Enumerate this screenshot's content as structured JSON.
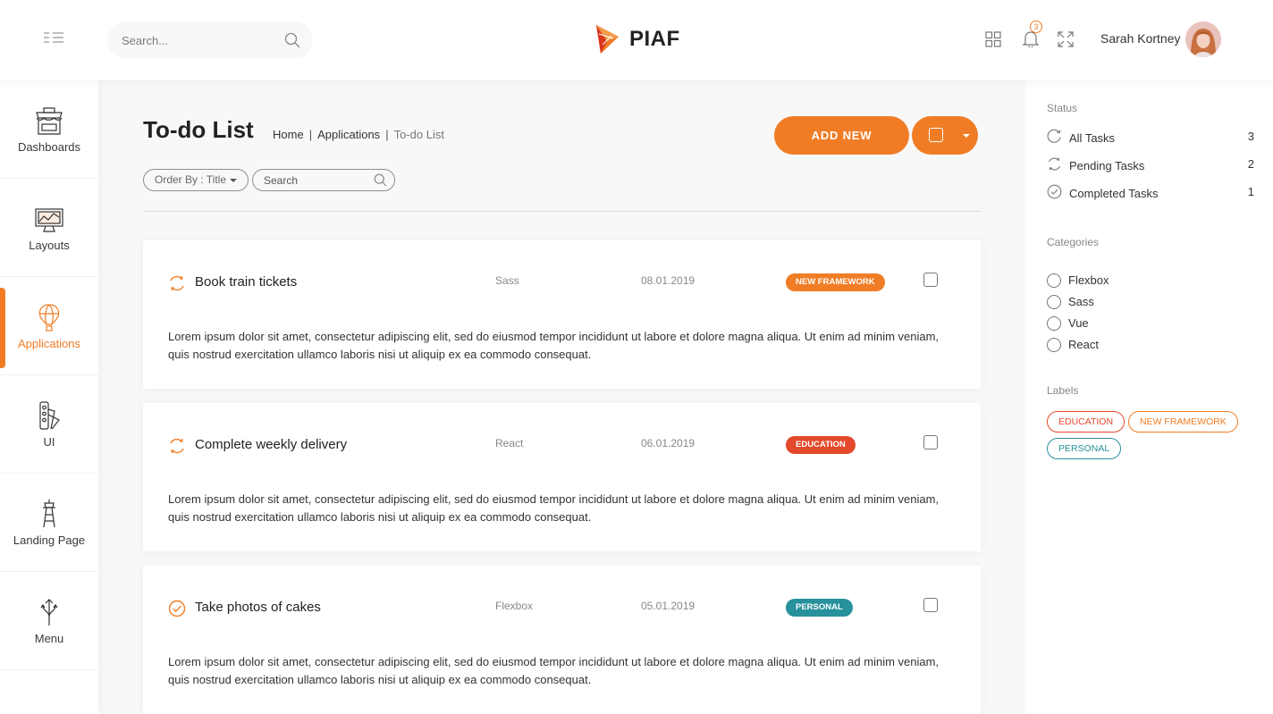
{
  "colors": {
    "accent": "#f07d26",
    "education": "#e3492b",
    "new_framework": "#f07d26",
    "personal": "#27919c"
  },
  "topbar": {
    "search_placeholder": "Search...",
    "logo_text": "PIAF",
    "notification_count": "3",
    "username": "Sarah Kortney"
  },
  "sidebar": {
    "items": [
      {
        "label": "Dashboards",
        "icon": "shop-icon"
      },
      {
        "label": "Layouts",
        "icon": "monitor-chart-icon"
      },
      {
        "label": "Applications",
        "icon": "air-balloon-icon",
        "active": true
      },
      {
        "label": "UI",
        "icon": "color-swatch-icon"
      },
      {
        "label": "Landing Page",
        "icon": "tower-icon"
      },
      {
        "label": "Menu",
        "icon": "split-arrows-icon"
      }
    ]
  },
  "main": {
    "title": "To-do List",
    "breadcrumb": {
      "home": "Home",
      "section": "Applications",
      "current": "To-do List",
      "separator": "|"
    },
    "add_new_label": "ADD NEW",
    "order_by_label": "Order By : Title",
    "search_placeholder": "Search",
    "tasks": [
      {
        "title": "Book train tickets",
        "category": "Sass",
        "date": "08.01.2019",
        "label": "NEW FRAMEWORK",
        "label_color": "#f07d26",
        "status": "pending",
        "description": "Lorem ipsum dolor sit amet, consectetur adipiscing elit, sed do eiusmod tempor incididunt ut labore et dolore magna aliqua. Ut enim ad minim veniam, quis nostrud exercitation ullamco laboris nisi ut aliquip ex ea commodo consequat."
      },
      {
        "title": "Complete weekly delivery",
        "category": "React",
        "date": "06.01.2019",
        "label": "EDUCATION",
        "label_color": "#e3492b",
        "status": "pending",
        "description": "Lorem ipsum dolor sit amet, consectetur adipiscing elit, sed do eiusmod tempor incididunt ut labore et dolore magna aliqua. Ut enim ad minim veniam, quis nostrud exercitation ullamco laboris nisi ut aliquip ex ea commodo consequat."
      },
      {
        "title": "Take photos of cakes",
        "category": "Flexbox",
        "date": "05.01.2019",
        "label": "PERSONAL",
        "label_color": "#27919c",
        "status": "completed",
        "description": "Lorem ipsum dolor sit amet, consectetur adipiscing elit, sed do eiusmod tempor incididunt ut labore et dolore magna aliqua. Ut enim ad minim veniam, quis nostrud exercitation ullamco laboris nisi ut aliquip ex ea commodo consequat."
      }
    ]
  },
  "right_panel": {
    "status_heading": "Status",
    "status": [
      {
        "label": "All Tasks",
        "count": "3",
        "icon": "refresh-icon"
      },
      {
        "label": "Pending Tasks",
        "count": "2",
        "icon": "pending-icon"
      },
      {
        "label": "Completed Tasks",
        "count": "1",
        "icon": "check-circle-icon"
      }
    ],
    "categories_heading": "Categories",
    "categories": [
      "Flexbox",
      "Sass",
      "Vue",
      "React"
    ],
    "labels_heading": "Labels",
    "labels": [
      {
        "text": "EDUCATION",
        "color": "#e3492b"
      },
      {
        "text": "NEW FRAMEWORK",
        "color": "#f07d26"
      },
      {
        "text": "PERSONAL",
        "color": "#27919c"
      }
    ]
  }
}
